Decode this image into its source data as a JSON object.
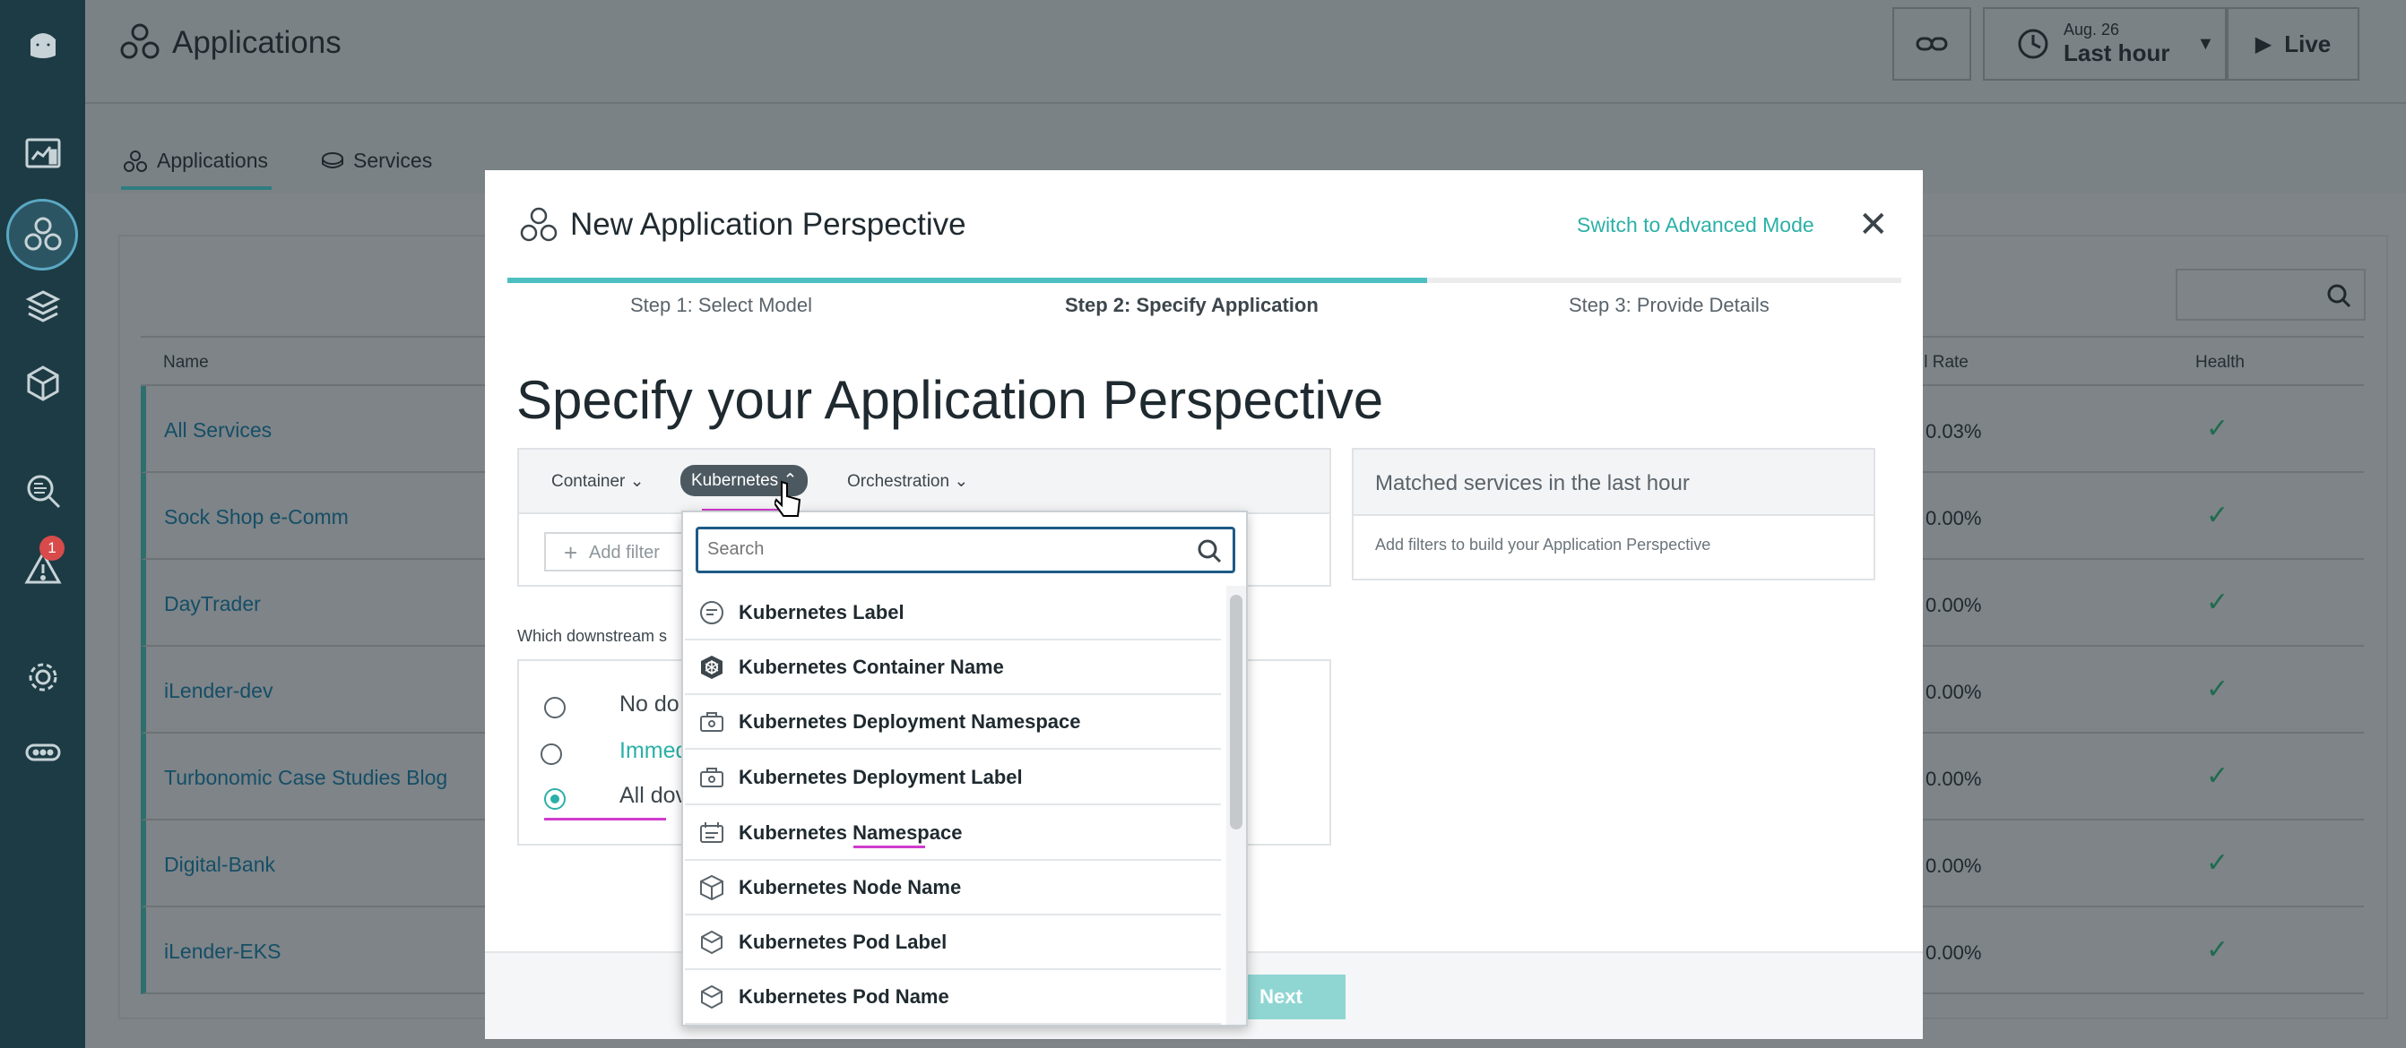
{
  "page": {
    "title": "Applications",
    "tabs": [
      {
        "label": "Applications",
        "icon": "applications-icon"
      },
      {
        "label": "Services",
        "icon": "services-icon"
      }
    ],
    "topbar": {
      "date_label": "Aug. 26",
      "range_label": "Last hour",
      "live_label": "Live"
    },
    "table": {
      "headers": [
        "Name",
        "ll Rate",
        "Health"
      ],
      "rows": [
        {
          "name": "All Services",
          "rate": "0.03%"
        },
        {
          "name": "Sock Shop e-Comm",
          "rate": "0.00%"
        },
        {
          "name": "DayTrader",
          "rate": "0.00%"
        },
        {
          "name": "iLender-dev",
          "rate": "0.00%"
        },
        {
          "name": "Turbonomic Case Studies Blog",
          "rate": "0.00%"
        },
        {
          "name": "Digital-Bank",
          "rate": "0.00%"
        },
        {
          "name": "iLender-EKS",
          "rate": "0.00%"
        }
      ]
    },
    "alert_badge": "1"
  },
  "modal": {
    "title": "New Application Perspective",
    "advanced_link": "Switch to Advanced Mode",
    "close_glyph": "✕",
    "steps": [
      "Step 1: Select Model",
      "Step 2: Specify Application",
      "Step 3: Provide Details"
    ],
    "progress": 0.66,
    "heading": "Specify your Application Perspective",
    "filter_categories": [
      "Container",
      "Kubernetes",
      "Orchestration"
    ],
    "add_filter": "Add filter",
    "matched_title": "Matched services in the last hour",
    "matched_hint": "Add filters to build your Application Perspective",
    "downstream_question": "Which downstream s",
    "radio_options": [
      "No do",
      "Immed",
      "All dov"
    ],
    "next_label": "Next"
  },
  "dropdown": {
    "search_placeholder": "Search",
    "items": [
      {
        "label": "Kubernetes Label",
        "icon": "label-icon"
      },
      {
        "label": "Kubernetes Container Name",
        "icon": "kubernetes-wheel-icon"
      },
      {
        "label": "Kubernetes Deployment Namespace",
        "icon": "deployment-icon"
      },
      {
        "label": "Kubernetes Deployment Label",
        "icon": "deployment-icon"
      },
      {
        "label": "Kubernetes Namespace",
        "icon": "namespace-icon"
      },
      {
        "label": "Kubernetes Node Name",
        "icon": "node-icon"
      },
      {
        "label": "Kubernetes Pod Label",
        "icon": "pod-icon"
      },
      {
        "label": "Kubernetes Pod Name",
        "icon": "pod-icon"
      }
    ]
  },
  "colors": {
    "accent": "#2bb0a8",
    "rail": "#1d3b44",
    "highlight_underline": "#d03ccd"
  }
}
